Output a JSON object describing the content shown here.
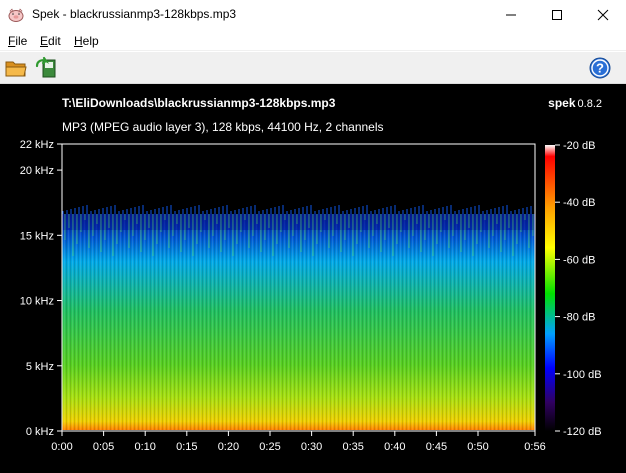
{
  "window": {
    "title": "Spek - blackrussianmp3-128kbps.mp3",
    "app_icon": "spek-pig-icon",
    "controls": [
      "minimize-icon",
      "maximize-icon",
      "close-icon"
    ]
  },
  "menu": {
    "items": [
      {
        "label": "File",
        "mnemonic": "F",
        "rest": "ile"
      },
      {
        "label": "Edit",
        "mnemonic": "E",
        "rest": "dit"
      },
      {
        "label": "Help",
        "mnemonic": "H",
        "rest": "elp"
      }
    ]
  },
  "toolbar": {
    "items": [
      {
        "name": "open-folder-icon"
      },
      {
        "name": "save-icon"
      },
      {
        "name": "help-icon"
      }
    ]
  },
  "spectrogram": {
    "file_path": "T:\\EliDownloads\\blackrussianmp3-128kbps.mp3",
    "info": "MP3 (MPEG audio layer 3), 128 kbps, 44100 Hz, 2 channels",
    "brand": "spek",
    "version": "0.8.2",
    "freq_ticks": [
      {
        "label": "22 kHz",
        "khz": 22
      },
      {
        "label": "20 kHz",
        "khz": 20
      },
      {
        "label": "15 kHz",
        "khz": 15
      },
      {
        "label": "10 kHz",
        "khz": 10
      },
      {
        "label": "5 kHz",
        "khz": 5
      },
      {
        "label": "0 kHz",
        "khz": 0
      }
    ],
    "time_ticks": [
      "0:00",
      "0:05",
      "0:10",
      "0:15",
      "0:20",
      "0:25",
      "0:30",
      "0:35",
      "0:40",
      "0:45",
      "0:50",
      "0:56"
    ],
    "db_ticks": [
      "-20 dB",
      "-40 dB",
      "-60 dB",
      "-80 dB",
      "-100 dB",
      "-120 dB"
    ],
    "colors": {
      "background": "#000000",
      "palette": [
        "#ffffff",
        "#ff0000",
        "#ffa000",
        "#ffff00",
        "#00e000",
        "#00a0ff",
        "#0000ff",
        "#300060",
        "#000000"
      ]
    }
  }
}
